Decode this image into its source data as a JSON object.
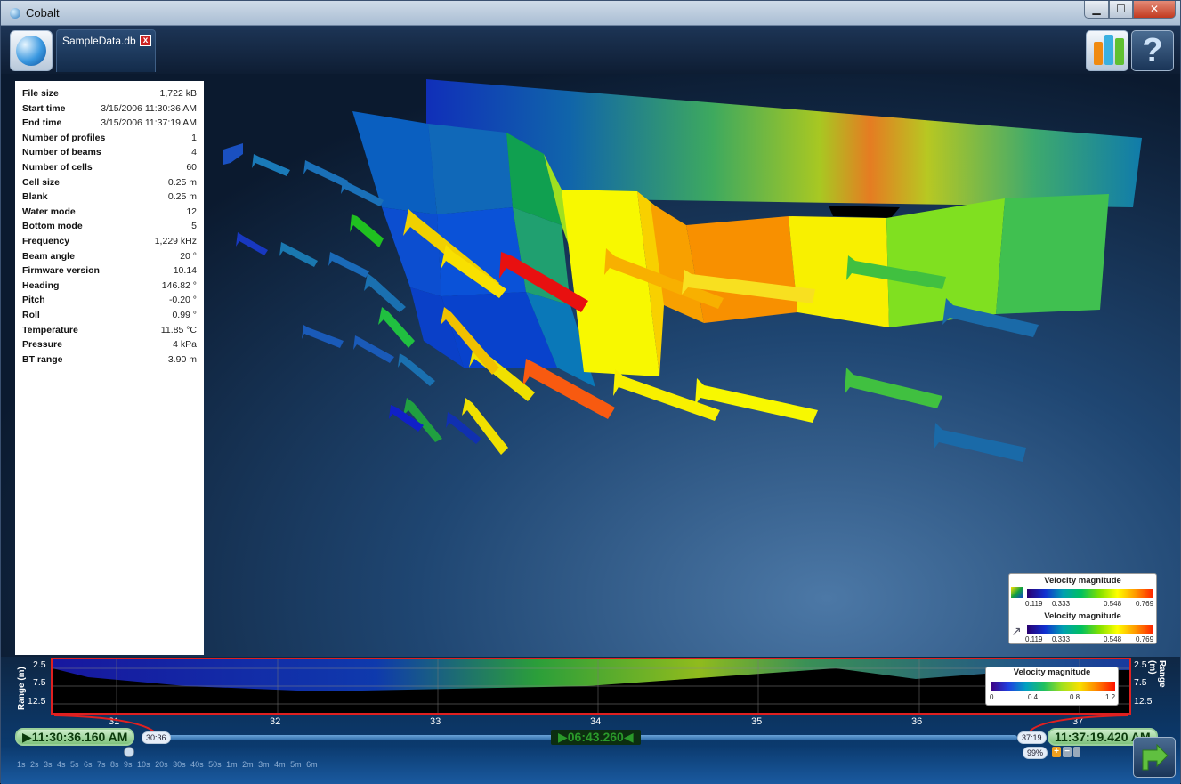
{
  "window": {
    "title": "Cobalt",
    "min_symbol": "▁",
    "max_symbol": "☐",
    "close_symbol": "✕"
  },
  "toolbar": {
    "tab_label": "SampleData.db",
    "tab_close": "x",
    "help_label": "?",
    "chart_icon_colors": [
      "#f08a10",
      "#3ab0e0",
      "#60c030"
    ]
  },
  "info": [
    {
      "k": "File size",
      "v": "1,722 kB"
    },
    {
      "k": "Start time",
      "v": "3/15/2006 11:30:36 AM"
    },
    {
      "k": "End time",
      "v": "3/15/2006 11:37:19 AM"
    },
    {
      "k": "Number of profiles",
      "v": "1"
    },
    {
      "k": "Number of beams",
      "v": "4"
    },
    {
      "k": "Number of cells",
      "v": "60"
    },
    {
      "k": "Cell size",
      "v": "0.25 m"
    },
    {
      "k": "Blank",
      "v": "0.25 m"
    },
    {
      "k": "Water mode",
      "v": "12"
    },
    {
      "k": "Bottom mode",
      "v": "5"
    },
    {
      "k": "Frequency",
      "v": "1,229 kHz"
    },
    {
      "k": "Beam angle",
      "v": "20 °"
    },
    {
      "k": "Firmware version",
      "v": "10.14"
    },
    {
      "k": "Heading",
      "v": "146.82 °"
    },
    {
      "k": "Pitch",
      "v": "-0.20 °"
    },
    {
      "k": "Roll",
      "v": "0.99 °"
    },
    {
      "k": "Temperature",
      "v": "11.85 °C"
    },
    {
      "k": "Pressure",
      "v": "4 kPa"
    },
    {
      "k": "BT range",
      "v": "3.90 m"
    }
  ],
  "legend_surface": {
    "title": "Velocity magnitude",
    "ticks": [
      "0.119",
      "0.333",
      "0.548",
      "0.769"
    ]
  },
  "legend_arrows": {
    "title": "Velocity magnitude",
    "ticks": [
      "0.119",
      "0.333",
      "0.548",
      "0.769"
    ]
  },
  "legend_strip": {
    "title": "Velocity magnitude",
    "ticks": [
      "0",
      "0.4",
      "0.8",
      "1.2"
    ]
  },
  "strip": {
    "ylabel": "Range (m)",
    "yticks": [
      "2.5",
      "7.5",
      "12.5"
    ],
    "xticks": [
      "31",
      "32",
      "33",
      "34",
      "35",
      "36",
      "37"
    ]
  },
  "timeline": {
    "start": "▶11:30:36.160 AM",
    "start_short": "30:36",
    "duration": "▶06:43.260◀",
    "end_short": "37:19",
    "end": "11:37:19.420 AM",
    "zoom_percent": "99%",
    "zoom_levels": "1s 2s 3s 4s 5s 6s 7s 8s 9s 10s 20s 30s 40s 50s 1m 2m 3m 4m 5m 6m"
  }
}
